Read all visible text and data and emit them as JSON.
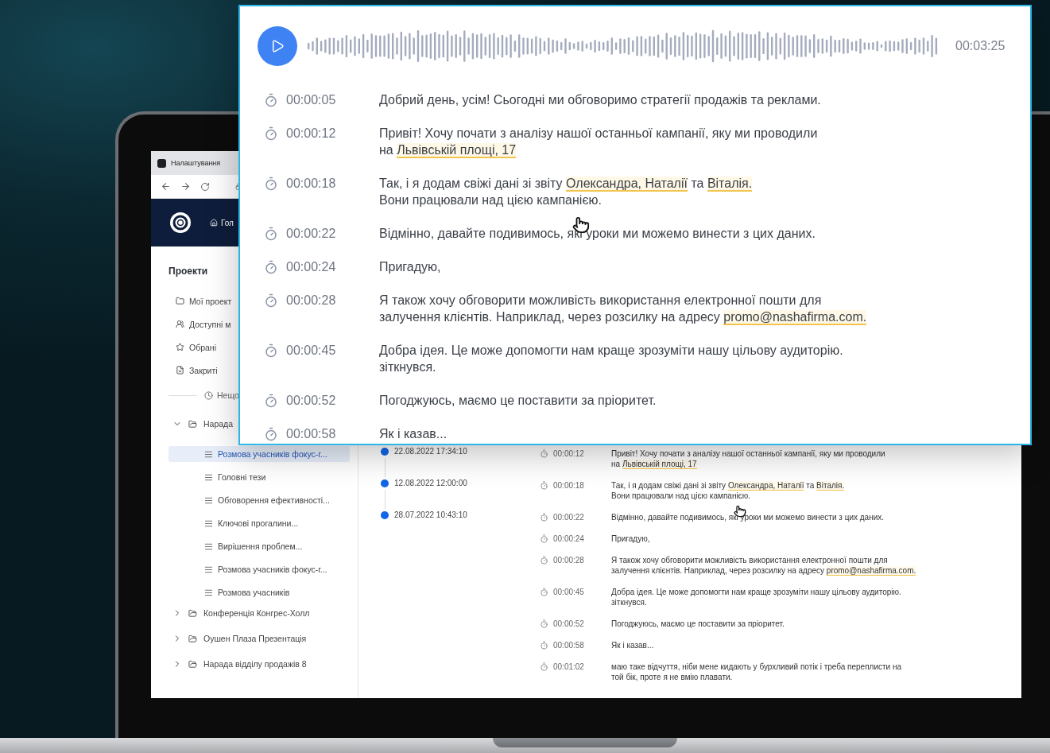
{
  "player_card": {
    "duration": "00:03:25",
    "transcript": [
      {
        "time": "00:00:05",
        "segments": [
          {
            "text": "Добрий день, усім! Сьогодні ми обговоримо стратегії продажів та реклами.",
            "highlight": false
          }
        ]
      },
      {
        "time": "00:00:12",
        "segments": [
          {
            "text": "Привіт! Хочу почати з аналізу нашої останньої кампанії, яку ми проводили\nна ",
            "highlight": false
          },
          {
            "text": "Львівській площі, 17",
            "highlight": true
          }
        ]
      },
      {
        "time": "00:00:18",
        "segments": [
          {
            "text": "Так, і я додам свіжі дані зі звіту ",
            "highlight": false
          },
          {
            "text": "Олександра, Наталії",
            "highlight": true
          },
          {
            "text": " та ",
            "highlight": false
          },
          {
            "text": "Віталія.",
            "highlight": true
          },
          {
            "text": "\nВони працювали над цією кампанією.",
            "highlight": false
          }
        ]
      },
      {
        "time": "00:00:22",
        "segments": [
          {
            "text": "Відмінно, давайте подивимось, які уроки ми можемо винести з цих даних.",
            "highlight": false
          }
        ]
      },
      {
        "time": "00:00:24",
        "segments": [
          {
            "text": "Пригадую,",
            "highlight": false
          }
        ]
      },
      {
        "time": "00:00:28",
        "segments": [
          {
            "text": "Я також хочу обговорити можливість використання електронної пошти для\nзалучення клієнтів. Наприклад, через розсилку на адресу ",
            "highlight": false
          },
          {
            "text": "promo@nashafirma.com.",
            "highlight": true
          }
        ]
      },
      {
        "time": "00:00:45",
        "segments": [
          {
            "text": "Добра ідея. Це може допомогти нам краще зрозуміти нашу цільову аудиторію.\nзіткнувся.",
            "highlight": false
          }
        ]
      },
      {
        "time": "00:00:52",
        "segments": [
          {
            "text": "Погоджуюсь, маємо це поставити за пріоритет.",
            "highlight": false
          }
        ]
      },
      {
        "time": "00:00:58",
        "segments": [
          {
            "text": "Як і казав...",
            "highlight": false
          }
        ]
      }
    ]
  },
  "browser": {
    "tab_title": "Налаштування"
  },
  "app_header": {
    "nav_label": "Гол"
  },
  "sidebar": {
    "title": "Проекти",
    "items": [
      {
        "label": "Мої проект"
      },
      {
        "label": "Доступні м"
      },
      {
        "label": "Обрані"
      },
      {
        "label": "Закриті"
      }
    ],
    "recent_label": "Нещо",
    "tree": [
      {
        "label": "Нарада",
        "expanded": true,
        "children": [
          {
            "label": "Розмова учасників фокус-г...",
            "selected": true
          },
          {
            "label": "Головні тези",
            "selected": false
          },
          {
            "label": "Обговорення ефективності...",
            "selected": false
          },
          {
            "label": "Ключові прогалини...",
            "selected": false
          },
          {
            "label": "Вирішення проблем...",
            "selected": false
          },
          {
            "label": "Розмова учасників фокус-г...",
            "selected": false
          },
          {
            "label": "Розмова учасників",
            "selected": false
          }
        ]
      },
      {
        "label": "Конференція Конгрес-Холл",
        "expanded": false
      },
      {
        "label": "Оушен Плаза Презентація",
        "expanded": false
      },
      {
        "label": "Нарада відділу продажів 8",
        "expanded": false
      }
    ]
  },
  "versions": [
    {
      "date": "22.08.2022 17:34:10"
    },
    {
      "date": "12.08.2022 12:00:00"
    },
    {
      "date": "28.07.2022 10:43:10"
    }
  ],
  "transcript": [
    {
      "time": "00:00:12",
      "segments": [
        {
          "text": "Привіт! Хочу почати з аналізу нашої останньої кампанії, яку ми проводили\nна ",
          "highlight": false
        },
        {
          "text": "Львівській площі, 17",
          "highlight": true
        }
      ]
    },
    {
      "time": "00:00:18",
      "segments": [
        {
          "text": "Так, і я додам свіжі дані зі звіту ",
          "highlight": false
        },
        {
          "text": "Олександра, Наталії",
          "highlight": true
        },
        {
          "text": " та ",
          "highlight": false
        },
        {
          "text": "Віталія.",
          "highlight": true
        },
        {
          "text": "\nВони працювали над цією кампанією.",
          "highlight": false
        }
      ]
    },
    {
      "time": "00:00:22",
      "segments": [
        {
          "text": "Відмінно, давайте подивимось, які уроки ми можемо винести з цих даних.",
          "highlight": false
        }
      ]
    },
    {
      "time": "00:00:24",
      "segments": [
        {
          "text": "Пригадую,",
          "highlight": false
        }
      ]
    },
    {
      "time": "00:00:28",
      "segments": [
        {
          "text": "Я також хочу обговорити можливість використання електронної пошти для\nзалучення клієнтів. Наприклад, через розсилку на адресу ",
          "highlight": false
        },
        {
          "text": "promo@nashafirma.com.",
          "highlight": true
        }
      ]
    },
    {
      "time": "00:00:45",
      "segments": [
        {
          "text": "Добра ідея. Це може допомогти нам краще зрозуміти нашу цільову аудиторію.\nзіткнувся.",
          "highlight": false
        }
      ]
    },
    {
      "time": "00:00:52",
      "segments": [
        {
          "text": "Погоджуюсь, маємо це поставити за пріоритет.",
          "highlight": false
        }
      ]
    },
    {
      "time": "00:00:58",
      "segments": [
        {
          "text": "Як і казав...",
          "highlight": false
        }
      ]
    },
    {
      "time": "00:01:02",
      "segments": [
        {
          "text": "маю таке відчуття, ніби мене кидають у бурхливий потік і треба переплисти на\nтой бік, проте я не вмію плавати.",
          "highlight": false
        }
      ]
    }
  ]
}
